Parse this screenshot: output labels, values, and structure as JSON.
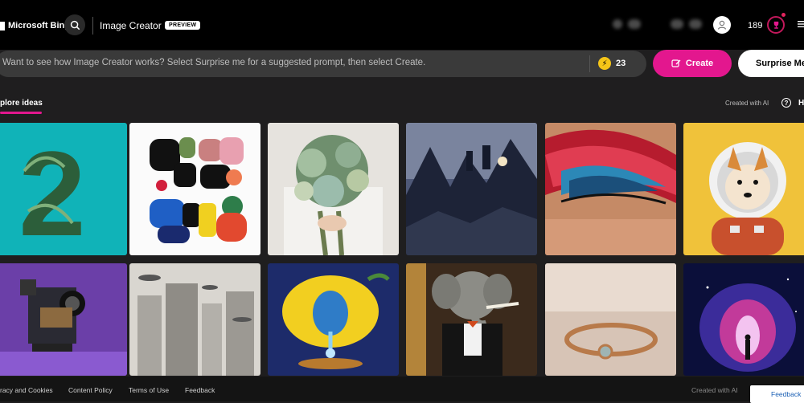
{
  "header": {
    "brand": "Microsoft Bing",
    "app_title": "Image Creator",
    "badge": "PREVIEW",
    "rewards_points": "189"
  },
  "prompt": {
    "placeholder": "Want to see how Image Creator works? Select Surprise me for a suggested prompt, then select Create.",
    "boosts": "23",
    "create_label": "Create",
    "surprise_label": "Surprise Me"
  },
  "explore": {
    "tab_label": "plore ideas",
    "created_with": "Created with AI",
    "help_label": "H"
  },
  "footer": {
    "links": [
      "racy and Cookies",
      "Content Policy",
      "Terms of Use",
      "Feedback"
    ],
    "credit": "Created with AI",
    "feedback_button": "Feedback"
  },
  "colors": {
    "accent": "#e3178e",
    "boost": "#f5c518",
    "header_bg": "#000000",
    "page_bg": "#1f1e1f"
  },
  "icons": [
    "bing-logo-icon",
    "search-icon",
    "avatar-icon",
    "trophy-icon",
    "menu-icon",
    "boost-icon",
    "create-icon",
    "help-icon",
    "feedback-icon"
  ]
}
